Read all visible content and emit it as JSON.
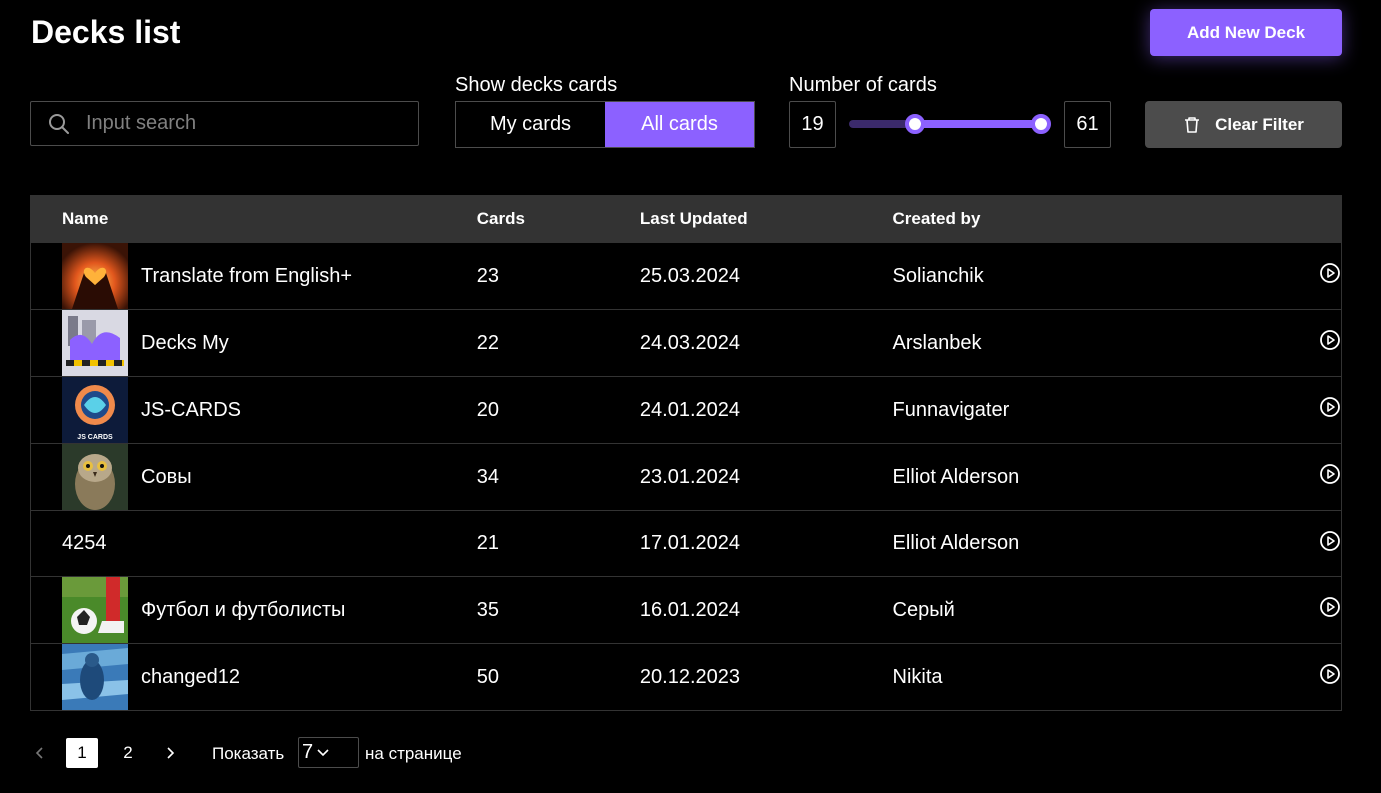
{
  "header": {
    "title": "Decks list",
    "add_button": "Add New Deck"
  },
  "filters": {
    "search_placeholder": "Input search",
    "show_label": "Show decks cards",
    "tabs": [
      {
        "label": "My cards",
        "active": false
      },
      {
        "label": "All cards",
        "active": true
      }
    ],
    "number_label": "Number of cards",
    "range_min": "19",
    "range_max": "61",
    "clear_button": "Clear Filter"
  },
  "table": {
    "columns": [
      "Name",
      "Cards",
      "Last Updated",
      "Created by"
    ],
    "rows": [
      {
        "name": "Translate from English+",
        "cards": "23",
        "updated": "25.03.2024",
        "author": "Solianchik",
        "has_cover": true
      },
      {
        "name": "Decks My",
        "cards": "22",
        "updated": "24.03.2024",
        "author": "Arslanbek",
        "has_cover": true
      },
      {
        "name": "JS-CARDS",
        "cards": "20",
        "updated": "24.01.2024",
        "author": "Funnavigater",
        "has_cover": true,
        "cover_text": "JS CARDS"
      },
      {
        "name": "Совы",
        "cards": "34",
        "updated": "23.01.2024",
        "author": "Elliot Alderson",
        "has_cover": true
      },
      {
        "name": "4254",
        "cards": "21",
        "updated": "17.01.2024",
        "author": "Elliot Alderson",
        "has_cover": false
      },
      {
        "name": "Футбол и футболисты",
        "cards": "35",
        "updated": "16.01.2024",
        "author": "Серый",
        "has_cover": true
      },
      {
        "name": "changed12",
        "cards": "50",
        "updated": "20.12.2023",
        "author": "Nikita",
        "has_cover": true
      }
    ]
  },
  "pagination": {
    "pages": [
      "1",
      "2"
    ],
    "current": "1",
    "show_label": "Показать",
    "per_page": "7",
    "per_page_suffix": "на странице"
  },
  "colors": {
    "accent": "#8c61ff",
    "surface": "#333333",
    "button_secondary": "#4c4c4c"
  },
  "icons": [
    "search-icon",
    "trash-icon",
    "play-icon",
    "chevron-left-icon",
    "chevron-right-icon",
    "chevron-down-icon"
  ]
}
